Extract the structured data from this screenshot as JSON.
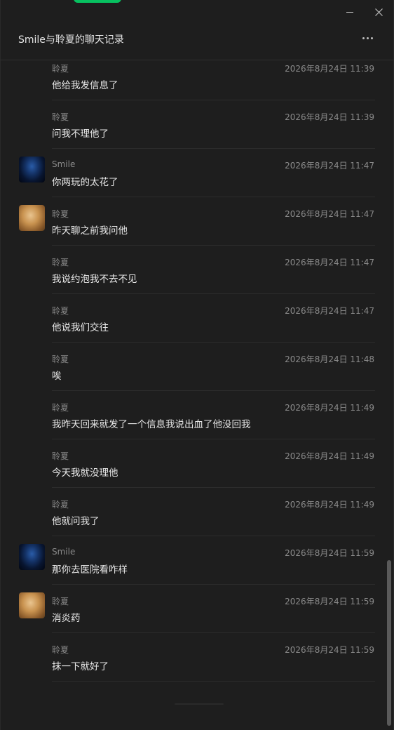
{
  "window": {
    "title": "Smile与聆夏的聊天记录",
    "accent_color": "#07c160",
    "buttons": {
      "minimize": "minimize-icon",
      "close": "close-icon",
      "more": "more-icon"
    }
  },
  "messages": [
    {
      "sender": "聆夏",
      "time": "2026年8月24日 11:39",
      "text": "他给我发信息了",
      "avatar": null
    },
    {
      "sender": "聆夏",
      "time": "2026年8月24日 11:39",
      "text": "问我不理他了",
      "avatar": null
    },
    {
      "sender": "Smile",
      "time": "2026年8月24日 11:47",
      "text": "你两玩的太花了",
      "avatar": "smile"
    },
    {
      "sender": "聆夏",
      "time": "2026年8月24日 11:47",
      "text": "昨天聊之前我问他",
      "avatar": "lingxia"
    },
    {
      "sender": "聆夏",
      "time": "2026年8月24日 11:47",
      "text": "我说约泡我不去不见",
      "avatar": null
    },
    {
      "sender": "聆夏",
      "time": "2026年8月24日 11:47",
      "text": "他说我们交往",
      "avatar": null
    },
    {
      "sender": "聆夏",
      "time": "2026年8月24日 11:48",
      "text": "唉",
      "avatar": null
    },
    {
      "sender": "聆夏",
      "time": "2026年8月24日 11:49",
      "text": "我昨天回来就发了一个信息我说出血了他没回我",
      "avatar": null
    },
    {
      "sender": "聆夏",
      "time": "2026年8月24日 11:49",
      "text": "今天我就没理他",
      "avatar": null
    },
    {
      "sender": "聆夏",
      "time": "2026年8月24日 11:49",
      "text": "他就问我了",
      "avatar": null
    },
    {
      "sender": "Smile",
      "time": "2026年8月24日 11:59",
      "text": "那你去医院看咋样",
      "avatar": "smile"
    },
    {
      "sender": "聆夏",
      "time": "2026年8月24日 11:59",
      "text": "消炎药",
      "avatar": "lingxia"
    },
    {
      "sender": "聆夏",
      "time": "2026年8月24日 11:59",
      "text": "抹一下就好了",
      "avatar": null
    }
  ]
}
